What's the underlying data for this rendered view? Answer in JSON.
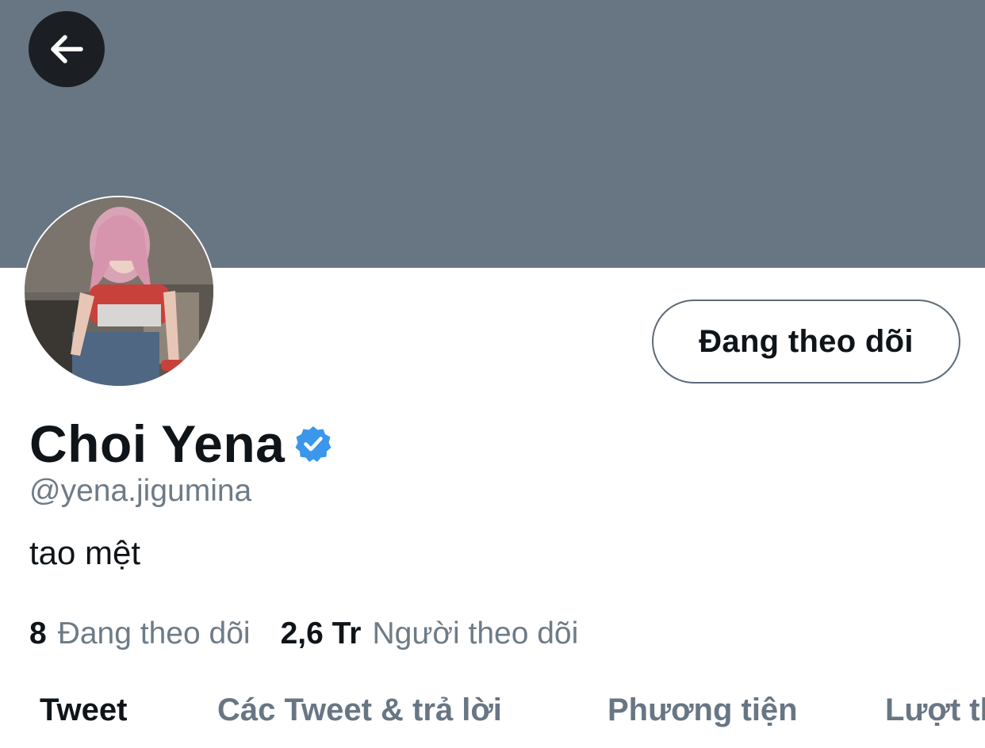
{
  "header": {
    "back_icon": "arrow-left-icon",
    "banner_color": "#687684"
  },
  "profile": {
    "name": "Choi Yena",
    "verified_icon": "verified-badge-icon",
    "verified_color": "#3b97ea",
    "handle": "@yena.jigumina",
    "bio": "tao mệt",
    "follow_button_label": "Đang theo dõi"
  },
  "stats": {
    "following_count": "8",
    "following_label": "Đang theo dõi",
    "followers_count": "2,6 Tr",
    "followers_label": "Người theo dõi"
  },
  "tabs": [
    {
      "label": "Tweet",
      "active": true
    },
    {
      "label": "Các Tweet & trả lời",
      "active": false
    },
    {
      "label": "Phương tiện",
      "active": false
    },
    {
      "label": "Lượt thích",
      "active": false
    }
  ]
}
